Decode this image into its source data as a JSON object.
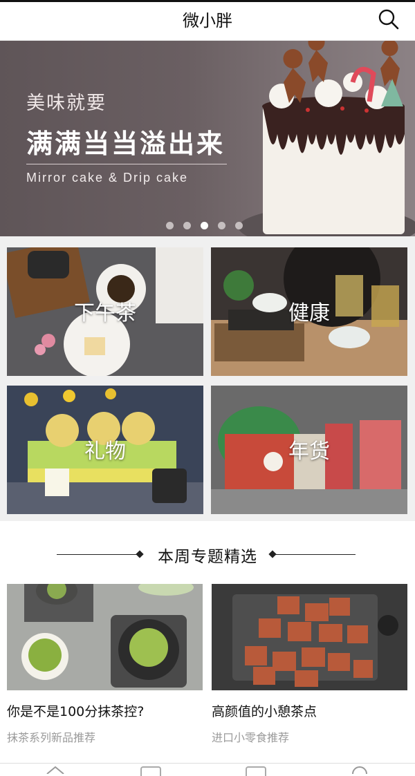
{
  "header": {
    "title": "微小胖",
    "search_icon": "search-icon"
  },
  "banner": {
    "line1": "美味就要",
    "line2": "满满当当溢出来",
    "line3": "Mirror cake & Drip cake",
    "page_count": 5,
    "active_page": 3
  },
  "categories": [
    {
      "label": "下午茶"
    },
    {
      "label": "健康"
    },
    {
      "label": "礼物"
    },
    {
      "label": "年货"
    }
  ],
  "section": {
    "title": "本周专题精选"
  },
  "features": [
    {
      "title": "你是不是100分抹茶控?",
      "subtitle": "抹茶系列新品推荐"
    },
    {
      "title": "高颜值的小憩茶点",
      "subtitle": "进口小零食推荐"
    }
  ],
  "tabbar": {
    "icons": [
      "home-icon",
      "category-icon",
      "cart-icon",
      "profile-icon"
    ]
  }
}
